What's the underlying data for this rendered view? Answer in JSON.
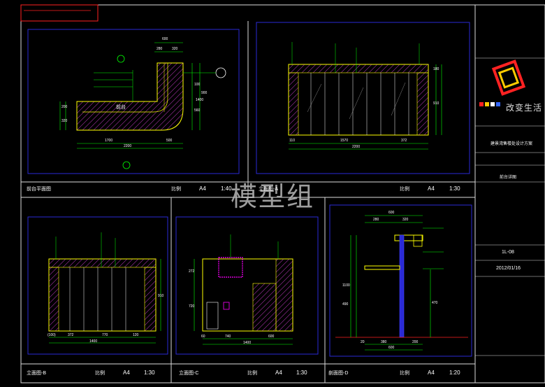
{
  "watermark": "模型组",
  "logo": {
    "text": "改变生活"
  },
  "project": {
    "title": "建景湾售楼处设计方案",
    "drawing_title": "前台详图",
    "drawing_no": "1L-08",
    "date": "2012/01/16"
  },
  "panels": [
    {
      "key": "plan",
      "title": "前台平面图",
      "scale_label": "比例",
      "paper": "A4",
      "scale": "1:40"
    },
    {
      "key": "elev_a",
      "title": "立面图-A",
      "scale_label": "比例",
      "paper": "A4",
      "scale": "1:30"
    },
    {
      "key": "elev_b",
      "title": "立面图-B",
      "scale_label": "比例",
      "paper": "A4",
      "scale": "1:30"
    },
    {
      "key": "elev_c",
      "title": "立面图-C",
      "scale_label": "比例",
      "paper": "A4",
      "scale": "1:30"
    },
    {
      "key": "sect_d",
      "title": "剖面图-D",
      "scale_label": "比例",
      "paper": "A4",
      "scale": "1:20"
    }
  ],
  "plan": {
    "counter_label": "前台",
    "dims": [
      "600",
      "280",
      "320",
      "1700",
      "500",
      "2200",
      "900",
      "560",
      "100",
      "1400",
      "200",
      "320"
    ]
  },
  "elev_a": {
    "dims": [
      "110",
      "1570",
      "372",
      "2200",
      "180",
      "910"
    ]
  },
  "elev_b": {
    "dims": [
      "(100)",
      "372",
      "770",
      "120",
      "1400",
      "910"
    ]
  },
  "elev_c": {
    "dims": [
      "60",
      "740",
      "600",
      "1400",
      "272",
      "720"
    ]
  },
  "sect_d": {
    "dims": [
      "600",
      "280",
      "320",
      "470",
      "1100",
      "490",
      "20",
      "380",
      "200",
      "600"
    ]
  },
  "colors": {
    "frame": "#2a2ad6",
    "dim": "#00ff00",
    "leader": "#00ff00",
    "counter": "#ffff00",
    "stone": "#cc33cc",
    "text_red": "#ff2020",
    "highlight": "#ff00ff"
  }
}
